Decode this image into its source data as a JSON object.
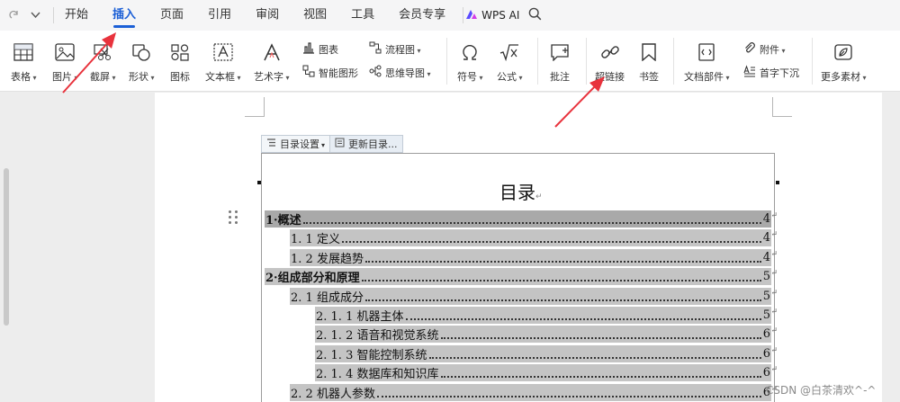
{
  "menubar": {
    "tabs": [
      {
        "label": "开始",
        "active": false
      },
      {
        "label": "插入",
        "active": true
      },
      {
        "label": "页面",
        "active": false
      },
      {
        "label": "引用",
        "active": false
      },
      {
        "label": "审阅",
        "active": false
      },
      {
        "label": "视图",
        "active": false
      },
      {
        "label": "工具",
        "active": false
      },
      {
        "label": "会员专享",
        "active": false
      }
    ],
    "ai_label": "WPS AI",
    "accent": "#1b5fd6"
  },
  "ribbon": {
    "table": "表格",
    "picture": "图片",
    "screenshot": "截屏",
    "shape": "形状",
    "icon": "图标",
    "textbox": "文本框",
    "wordart": "艺术字",
    "chart": "图表",
    "smartart": "智能图形",
    "flowchart": "流程图",
    "mindmap": "思维导图",
    "symbol": "符号",
    "formula": "公式",
    "comment": "批注",
    "hyperlink": "超链接",
    "bookmark": "书签",
    "docparts": "文档部件",
    "attachment": "附件",
    "dropcap": "首字下沉",
    "more": "更多素材"
  },
  "toc_toolbar": {
    "settings": "目录设置",
    "update": "更新目录..."
  },
  "toc": {
    "title": "目录",
    "entries": [
      {
        "num": "1",
        "text": "概述",
        "page": "4",
        "level": 1
      },
      {
        "num": "1. 1",
        "text": "定义",
        "page": "4",
        "level": 2
      },
      {
        "num": "1. 2",
        "text": "发展趋势",
        "page": "4",
        "level": 2
      },
      {
        "num": "2",
        "text": "组成部分和原理",
        "page": "5",
        "level": 1
      },
      {
        "num": "2. 1",
        "text": "组成成分",
        "page": "5",
        "level": 2
      },
      {
        "num": "2. 1. 1",
        "text": "机器主体",
        "page": "5",
        "level": 3
      },
      {
        "num": "2. 1. 2",
        "text": "语音和视觉系统",
        "page": "6",
        "level": 3
      },
      {
        "num": "2. 1. 3",
        "text": "智能控制系统",
        "page": "6",
        "level": 3
      },
      {
        "num": "2. 1. 4",
        "text": "数据库和知识库",
        "page": "6",
        "level": 3
      },
      {
        "num": "2. 2",
        "text": "机器人参数",
        "page": "6",
        "level": 2
      }
    ]
  },
  "watermark": "CSDN @白茶清欢^-^"
}
